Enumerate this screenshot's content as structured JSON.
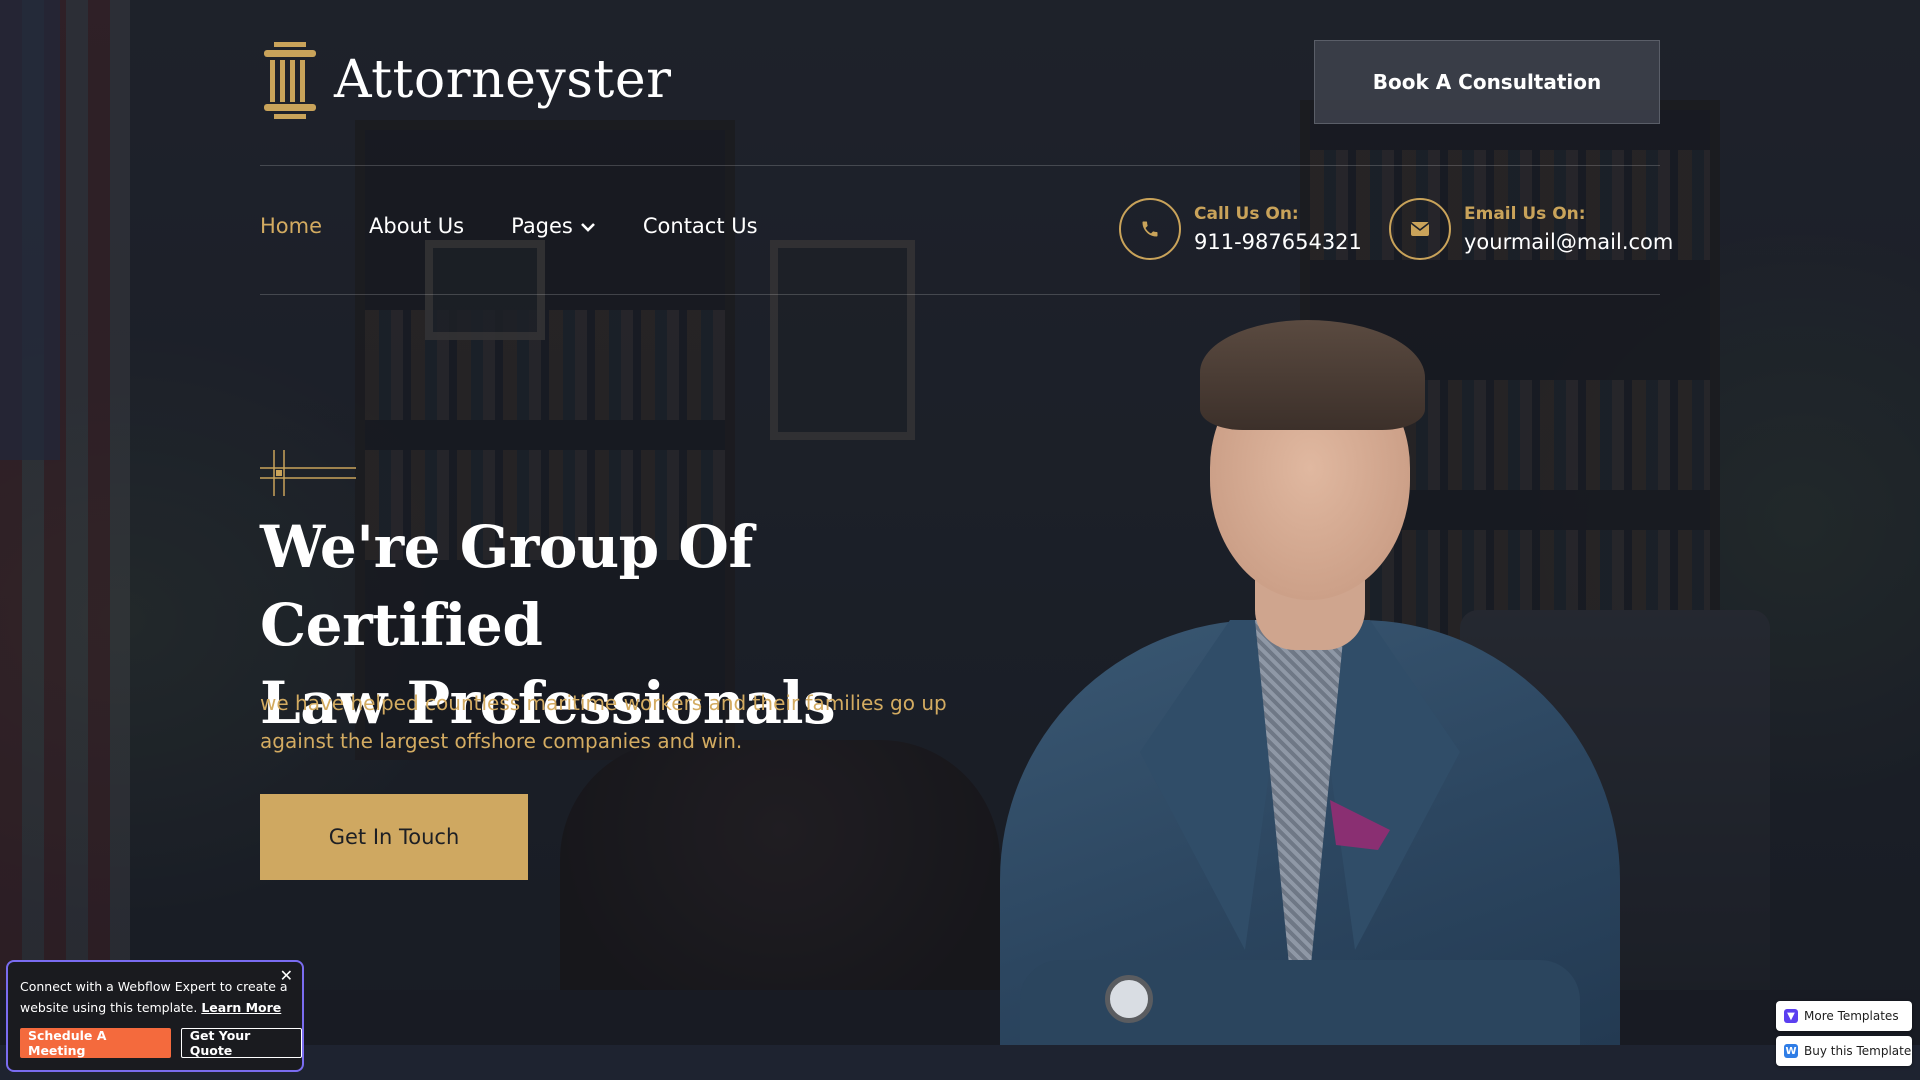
{
  "header": {
    "logo_text": "Attorneyster",
    "cta_label": "Book A Consultation"
  },
  "nav": {
    "items": [
      {
        "label": "Home",
        "active": true
      },
      {
        "label": "About Us",
        "active": false
      },
      {
        "label": "Pages",
        "active": false,
        "has_dropdown": true
      },
      {
        "label": "Contact Us",
        "active": false
      }
    ],
    "phone": {
      "label": "Call Us On:",
      "value": "911-987654321",
      "icon": "phone-icon"
    },
    "email": {
      "label": "Email Us On:",
      "value": "yourmail@mail.com",
      "icon": "mail-icon"
    }
  },
  "hero": {
    "title_line1": "We're Group Of Certified",
    "title_line2": "Law Professionals",
    "subtitle_line1": "we have helped countless maritime workers and their families go up",
    "subtitle_line2": "against the largest offshore companies and win.",
    "cta_label": "Get In Touch"
  },
  "popup": {
    "text": "Connect with a Webflow Expert to create a website using this template.",
    "link": "Learn More",
    "close_glyph": "✕",
    "primary_label": "Schedule A Meeting",
    "secondary_label": "Get Your Quote"
  },
  "template_buttons": {
    "more": "More Templates",
    "buy": "Buy this Template"
  },
  "colors": {
    "accent_gold": "#cfa861",
    "background": "#1c2029",
    "popup_border": "#7a6cf0",
    "popup_primary": "#f46a3d"
  }
}
